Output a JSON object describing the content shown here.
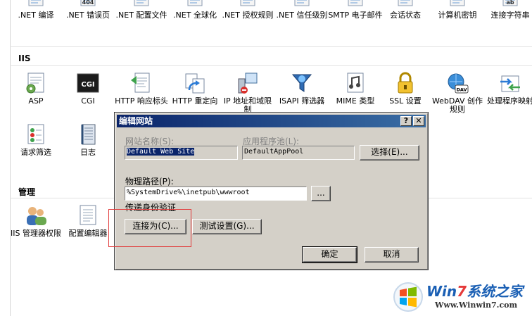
{
  "top_row": [
    {
      "name": "net-compilation",
      "label": ".NET 编译",
      "badge": ""
    },
    {
      "name": "net-error-pages",
      "label": ".NET 错误页",
      "badge": "404"
    },
    {
      "name": "net-config-file",
      "label": ".NET 配置文件",
      "badge": ""
    },
    {
      "name": "net-globalization",
      "label": ".NET 全球化",
      "badge": ""
    },
    {
      "name": "net-authorization-rules",
      "label": ".NET 授权规则",
      "badge": ""
    },
    {
      "name": "net-trust-level",
      "label": ".NET 信任级别",
      "badge": ""
    },
    {
      "name": "smtp-email",
      "label": "SMTP 电子邮件",
      "badge": ""
    },
    {
      "name": "session-state",
      "label": "会话状态",
      "badge": ""
    },
    {
      "name": "machine-key",
      "label": "计算机密钥",
      "badge": ""
    },
    {
      "name": "connection-strings",
      "label": "连接字符串",
      "badge": "ab"
    }
  ],
  "iis_section": {
    "title": "IIS",
    "row1": [
      {
        "name": "asp",
        "label": "ASP",
        "icon": "asp-icon"
      },
      {
        "name": "cgi",
        "label": "CGI",
        "icon": "cgi-icon",
        "badge": "CGI"
      },
      {
        "name": "http-response-headers",
        "label": "HTTP 响应标头",
        "icon": "response-headers-icon"
      },
      {
        "name": "http-redirect",
        "label": "HTTP 重定向",
        "icon": "redirect-icon"
      },
      {
        "name": "ip-domain-restrictions",
        "label": "IP 地址和域限制",
        "icon": "ip-restrictions-icon"
      },
      {
        "name": "isapi-filters",
        "label": "ISAPI 筛选器",
        "icon": "isapi-filters-icon"
      },
      {
        "name": "mime-types",
        "label": "MIME 类型",
        "icon": "mime-types-icon"
      },
      {
        "name": "ssl-settings",
        "label": "SSL 设置",
        "icon": "lock-icon"
      },
      {
        "name": "webdav-rules",
        "label": "WebDAV 创作规则",
        "icon": "webdav-icon",
        "badge": "DAV"
      },
      {
        "name": "handler-mappings",
        "label": "处理程序映射",
        "icon": "handler-mappings-icon"
      }
    ],
    "row2": [
      {
        "name": "request-filtering",
        "label": "请求筛选",
        "icon": "request-filter-icon"
      },
      {
        "name": "logging",
        "label": "日志",
        "icon": "log-icon"
      }
    ]
  },
  "manage_section": {
    "title": "管理",
    "items": [
      {
        "name": "iis-manager-permissions",
        "label": "IIS 管理器权限",
        "icon": "users-icon"
      },
      {
        "name": "configuration-editor",
        "label": "配置编辑器",
        "icon": "config-editor-icon"
      }
    ]
  },
  "dialog": {
    "title": "编辑网站",
    "help_button": "?",
    "close_button": "✕",
    "site_name_label": "网站名称(S):",
    "site_name_value": "Default Web Site",
    "app_pool_label": "应用程序池(L):",
    "app_pool_value": "DefaultAppPool",
    "select_button": "选择(E)...",
    "physical_path_label": "物理路径(P):",
    "physical_path_value": "%SystemDrive%\\inetpub\\wwwroot",
    "browse_button": "...",
    "passthrough_label": "传递身份验证",
    "connect_as_button": "连接为(C)...",
    "test_settings_button": "测试设置(G)...",
    "ok_button": "确定",
    "cancel_button": "取消"
  },
  "watermark": {
    "title_prefix": "Win",
    "title_seven": "7",
    "title_suffix": "系统之家",
    "url": "Www.Winwin7.com"
  },
  "colors": {
    "titlebar_start": "#0a246a",
    "titlebar_end": "#3a6ea5",
    "dialog_face": "#d4d0c8",
    "highlight_box": "#e23a3a"
  }
}
